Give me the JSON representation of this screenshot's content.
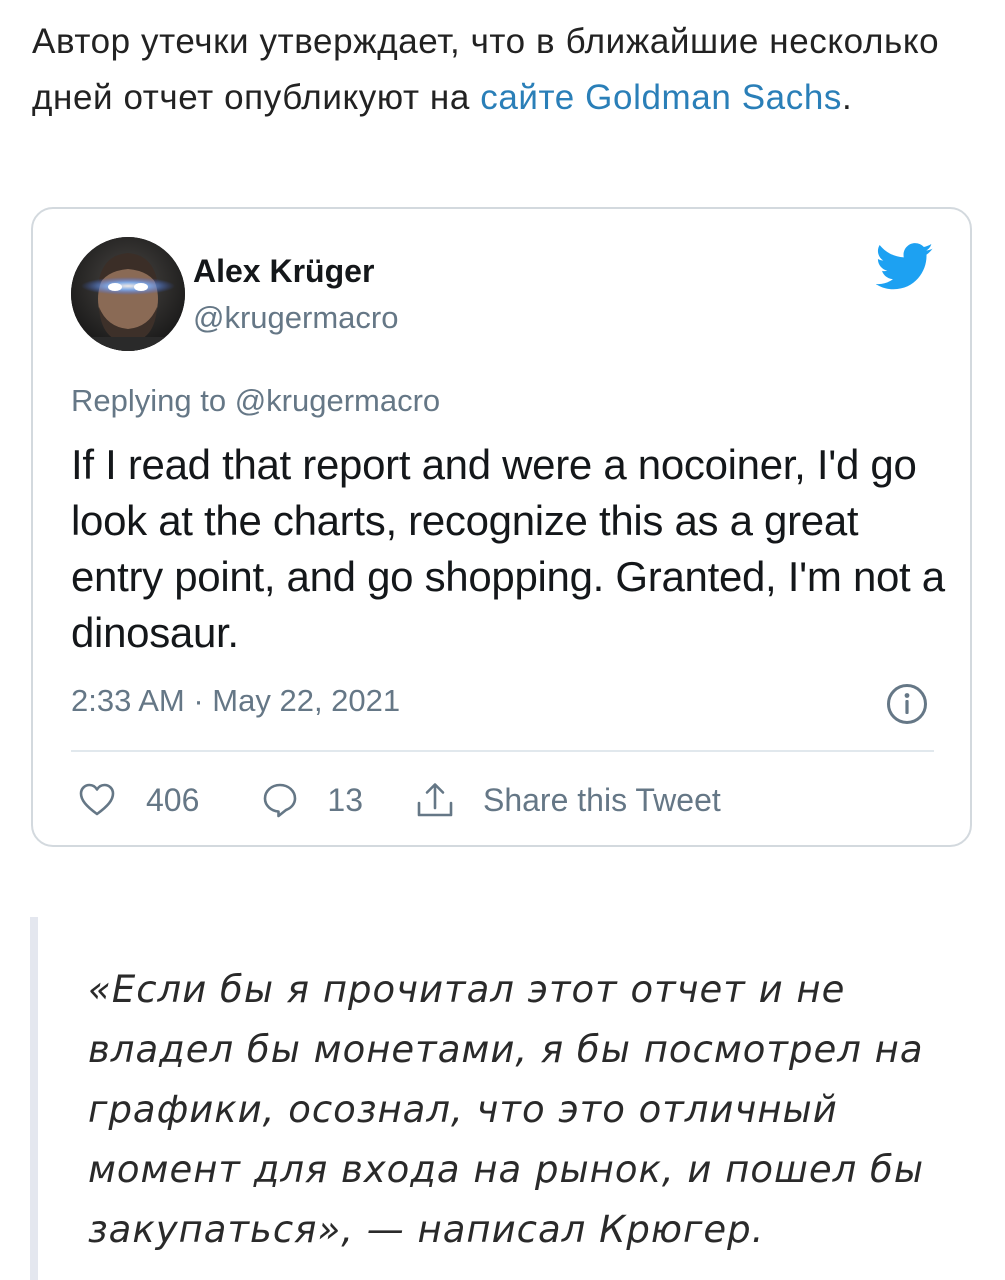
{
  "intro": {
    "text_before": "Автор утечки утверждает, что в ближайшие несколько дней отчет опубликуют на ",
    "link_text": "сайте Goldman Sachs",
    "text_after": "."
  },
  "tweet": {
    "author_name": "Alex Krüger",
    "author_handle": "@krugermacro",
    "replying_to": "Replying to @krugermacro",
    "text": "If I read that report and were a nocoiner, I'd go look at the charts, recognize this as a great entry point, and go shopping. Granted, I'm not a dinosaur.",
    "timestamp": "2:33 AM · May 22, 2021",
    "likes": "406",
    "replies": "13",
    "share_label": "Share this Tweet"
  },
  "quote": {
    "text": "«Если бы я прочитал этот отчет и не владел бы монетами, я бы посмотрел на графики, осознал, что это отличный момент для входа на рынок, и пошел бы закупаться», — написал Крюгер."
  },
  "colors": {
    "link": "#2a7fb8",
    "twitter_blue": "#1da1f2",
    "secondary_text": "#657786",
    "border": "#d3d9de",
    "quote_bar": "#e4e7ef"
  },
  "icons": {
    "brand": "twitter-bird-icon",
    "info": "info-icon",
    "like": "heart-icon",
    "reply": "speech-bubble-icon",
    "share": "share-icon"
  }
}
